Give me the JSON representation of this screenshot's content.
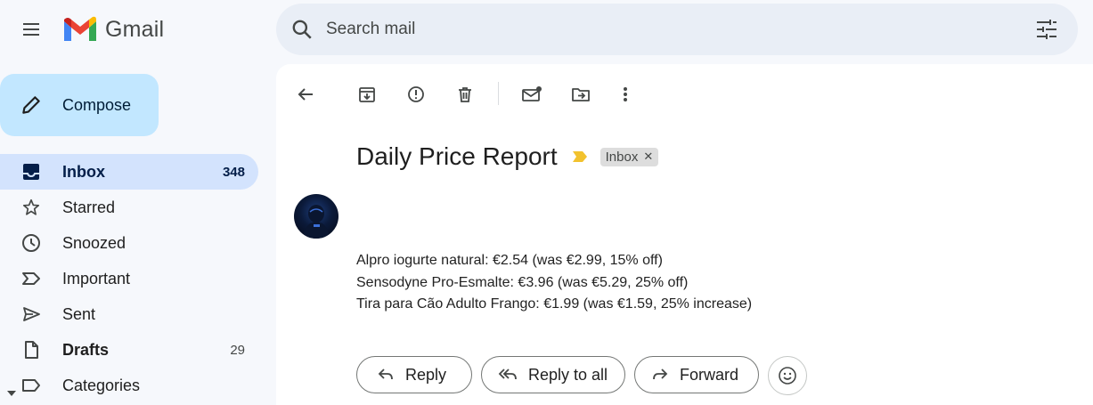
{
  "app": {
    "name": "Gmail"
  },
  "search": {
    "placeholder": "Search mail"
  },
  "sidebar": {
    "compose_label": "Compose",
    "items": [
      {
        "label": "Inbox",
        "count": "348",
        "icon": "inbox-icon"
      },
      {
        "label": "Starred",
        "count": "",
        "icon": "star-icon"
      },
      {
        "label": "Snoozed",
        "count": "",
        "icon": "clock-icon"
      },
      {
        "label": "Important",
        "count": "",
        "icon": "important-icon"
      },
      {
        "label": "Sent",
        "count": "",
        "icon": "send-icon"
      },
      {
        "label": "Drafts",
        "count": "29",
        "icon": "draft-icon"
      },
      {
        "label": "Categories",
        "count": "",
        "icon": "label-icon"
      }
    ]
  },
  "email": {
    "subject": "Daily Price Report",
    "label": "Inbox",
    "body": [
      "Alpro iogurte natural: €2.54 (was €2.99, 15% off)",
      "Sensodyne Pro-Esmalte: €3.96 (was €5.29, 25% off)",
      "Tira para Cão Adulto Frango: €1.99 (was €1.59, 25% increase)"
    ]
  },
  "actions": {
    "reply": "Reply",
    "reply_all": "Reply to all",
    "forward": "Forward"
  },
  "colors": {
    "background": "#f6f8fc",
    "search_bg": "#e9eef6",
    "compose_bg": "#c2e7ff",
    "active_nav_bg": "#d3e3fd",
    "importance_marker": "#f2c22e"
  }
}
